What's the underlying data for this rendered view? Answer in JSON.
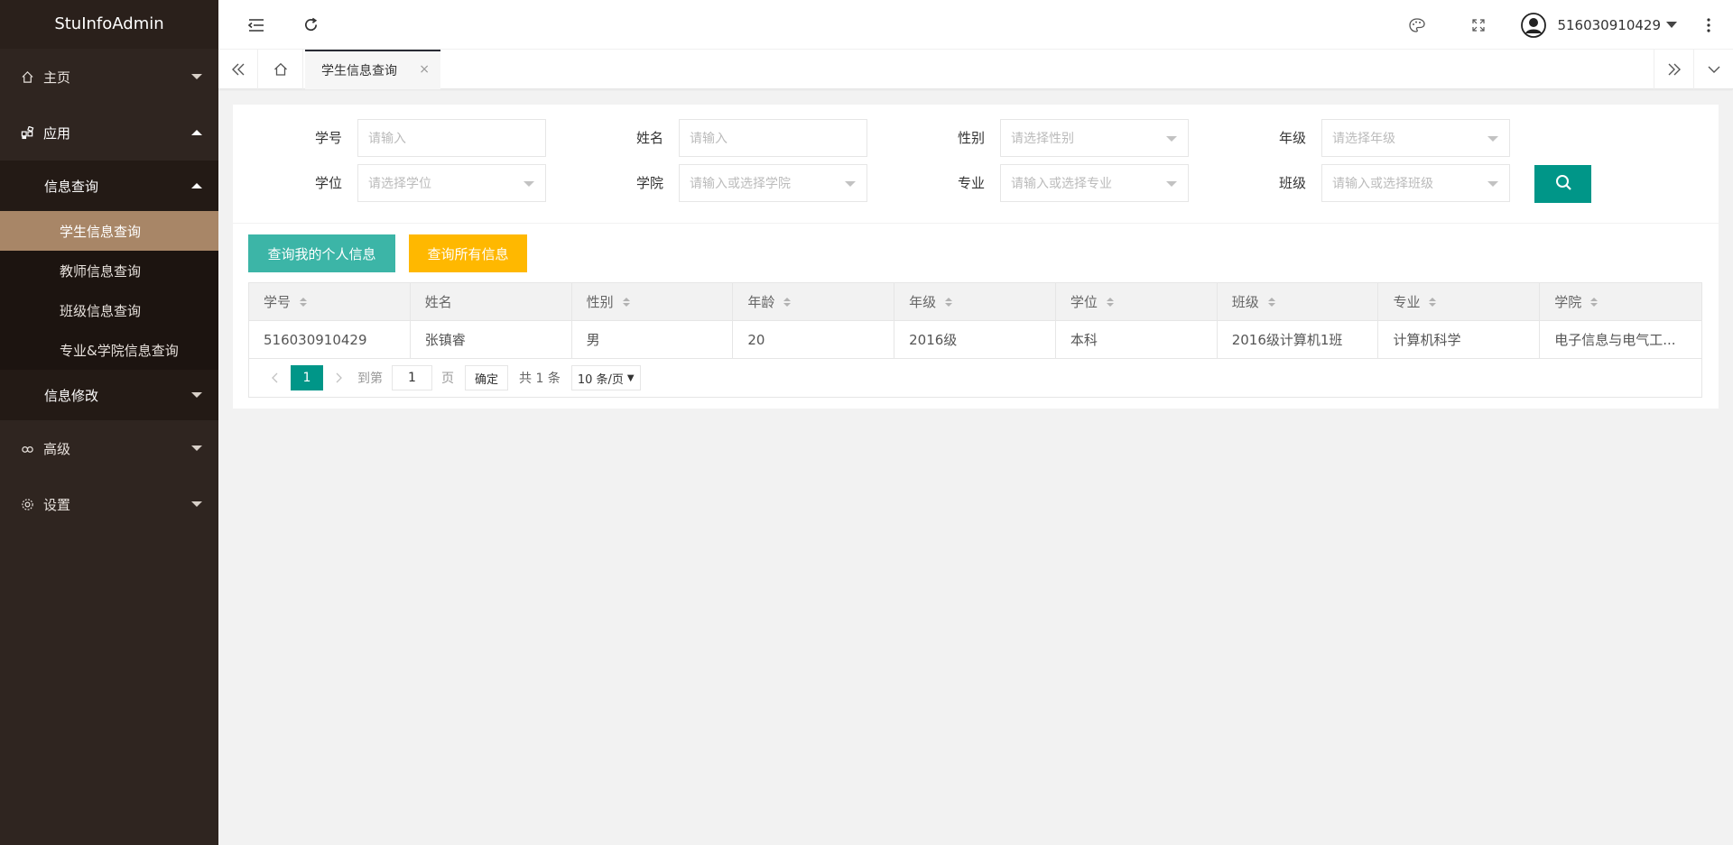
{
  "app": {
    "title": "StuInfoAdmin"
  },
  "sidebar": {
    "items": [
      {
        "label": "主页"
      },
      {
        "label": "应用"
      },
      {
        "label": "高级"
      },
      {
        "label": "设置"
      }
    ],
    "info_query": {
      "label": "信息查询",
      "items": [
        "学生信息查询",
        "教师信息查询",
        "班级信息查询",
        "专业&学院信息查询"
      ]
    },
    "info_modify": {
      "label": "信息修改"
    }
  },
  "header": {
    "username": "516030910429"
  },
  "tabs": {
    "active": "学生信息查询",
    "close": "×"
  },
  "filters": {
    "student_id": {
      "label": "学号",
      "placeholder": "请输入"
    },
    "name": {
      "label": "姓名",
      "placeholder": "请输入"
    },
    "gender": {
      "label": "性别",
      "placeholder": "请选择性别"
    },
    "grade": {
      "label": "年级",
      "placeholder": "请选择年级"
    },
    "degree": {
      "label": "学位",
      "placeholder": "请选择学位"
    },
    "college": {
      "label": "学院",
      "placeholder": "请输入或选择学院"
    },
    "major": {
      "label": "专业",
      "placeholder": "请输入或选择专业"
    },
    "class": {
      "label": "班级",
      "placeholder": "请输入或选择班级"
    }
  },
  "actions": {
    "my_info": "查询我的个人信息",
    "all_info": "查询所有信息"
  },
  "table": {
    "columns": [
      "学号",
      "姓名",
      "性别",
      "年龄",
      "年级",
      "学位",
      "班级",
      "专业",
      "学院"
    ],
    "rows": [
      [
        "516030910429",
        "张镇睿",
        "男",
        "20",
        "2016级",
        "本科",
        "2016级计算机1班",
        "计算机科学",
        "电子信息与电气工..."
      ]
    ]
  },
  "pagination": {
    "current": "1",
    "goto_label": "到第",
    "page_input": "1",
    "page_label": "页",
    "confirm": "确定",
    "total": "共 1 条",
    "page_size": "10 条/页"
  },
  "colors": {
    "sidebar_bg": "#2f2520",
    "active_item": "#a88667",
    "primary": "#009688",
    "teal": "#3cb5a7",
    "yellow": "#ffb800"
  }
}
